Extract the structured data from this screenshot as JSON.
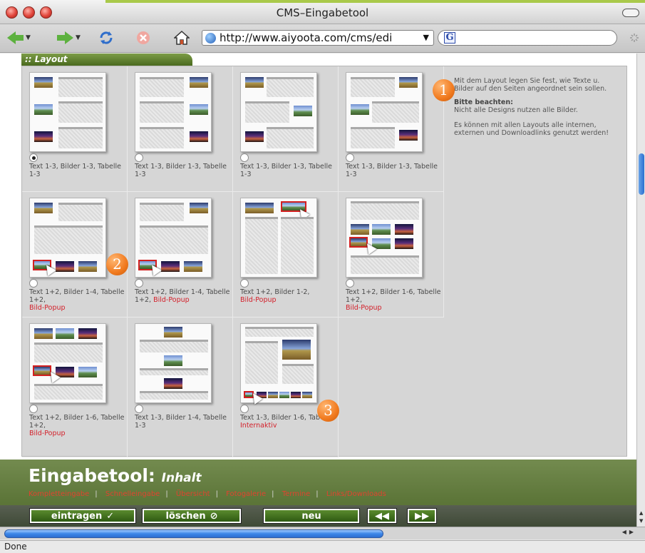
{
  "window": {
    "title": "CMS–Eingabetool",
    "url": "http://www.aiyoota.com/cms/edi",
    "status": "Done"
  },
  "layout_panel": {
    "tab_label": ":: Layout",
    "options": [
      {
        "caption": "Text 1-3, Bilder 1-3, Tabelle 1-3",
        "extra": "",
        "selected": true
      },
      {
        "caption": "Text 1-3, Bilder 1-3, Tabelle 1-3",
        "extra": "",
        "selected": false
      },
      {
        "caption": "Text 1-3, Bilder 1-3, Tabelle 1-3",
        "extra": "",
        "selected": false
      },
      {
        "caption": "Text 1-3, Bilder 1-3, Tabelle 1-3",
        "extra": "",
        "selected": false
      },
      {
        "caption": "Text 1+2, Bilder 1-4, Tabelle 1+2,",
        "extra": "Bild-Popup",
        "selected": false
      },
      {
        "caption": "Text 1+2, Bilder 1-4, Tabelle 1+2,",
        "extra": "Bild-Popup",
        "selected": false
      },
      {
        "caption": "Text 1+2, Bilder 1-2,",
        "extra": "Bild-Popup",
        "selected": false
      },
      {
        "caption": "Text 1+2, Bilder 1-6, Tabelle 1+2,",
        "extra": "Bild-Popup",
        "selected": false
      },
      {
        "caption": "Text 1+2, Bilder 1-6, Tabelle 1+2,",
        "extra": "Bild-Popup",
        "selected": false
      },
      {
        "caption": "Text 1-3, Bilder 1-4, Tabelle 1-3",
        "extra": "",
        "selected": false
      },
      {
        "caption": "Text 1-3, Bilder 1-6, Tabelle,",
        "extra": "Internaktiv",
        "selected": false
      }
    ],
    "info": {
      "line1": "Mit dem Layout legen Sie fest, wie Texte u. Bilder auf den Seiten angeordnet sein sollen.",
      "heading": "Bitte beachten:",
      "line2": "Nicht alle Designs nutzen alle Bilder.",
      "line3": "Es können mit allen Layouts alle internen, externen und Downloadlinks genutzt werden!"
    },
    "badges": [
      "1",
      "2",
      "3"
    ]
  },
  "footer": {
    "title": "Eingabetool:",
    "subtitle": "Inhalt",
    "links": [
      "Kompletteingabe",
      "Schnelleingabe",
      "Übersicht",
      "Fotogalerie",
      "Termine",
      "Links/Downloads"
    ],
    "buttons": {
      "save": "eintragen",
      "delete": "löschen",
      "new": "neu"
    }
  },
  "colors": {
    "accent_green": "#5d7639",
    "link_red": "#e0432f",
    "badge_orange": "#f17a1e"
  }
}
